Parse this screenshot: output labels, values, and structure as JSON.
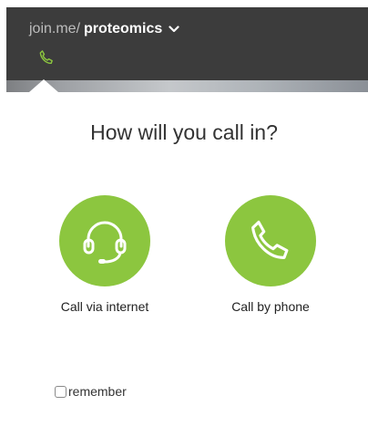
{
  "header": {
    "room_prefix": "join.me/",
    "room_name": "proteomics"
  },
  "dialog": {
    "title": "How will you call in?",
    "options": [
      {
        "label": "Call via internet",
        "icon": "headset-icon"
      },
      {
        "label": "Call by phone",
        "icon": "phone-icon"
      }
    ],
    "remember_label": "remember",
    "remember_checked": false
  },
  "colors": {
    "accent": "#8cc63f",
    "header_bg": "#3c3c3c"
  }
}
